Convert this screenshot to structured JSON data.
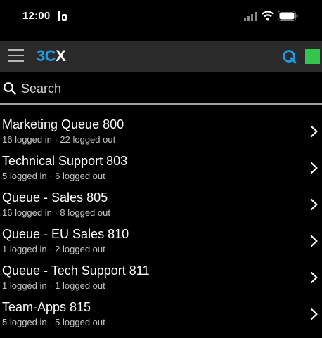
{
  "status_bar": {
    "time": "12:00",
    "icons": [
      "focus-mode-icon",
      "signal-icon",
      "wifi-icon",
      "battery-icon"
    ]
  },
  "header": {
    "logo_prefix": "3",
    "logo_mid": "C",
    "logo_suffix": "X",
    "icons": [
      "menu-icon",
      "q-icon",
      "presence-status"
    ],
    "presence_color": "#33c54d",
    "accent_color": "#1e9be3"
  },
  "search": {
    "placeholder": "Search"
  },
  "queues": [
    {
      "name": "Marketing Queue 800",
      "status": "16 logged in · 22 logged out"
    },
    {
      "name": "Technical Support 803",
      "status": "5 logged in · 6 logged out"
    },
    {
      "name": "Queue - Sales 805",
      "status": "16 logged in · 8 logged out"
    },
    {
      "name": "Queue - EU Sales 810",
      "status": "1 logged in · 2 logged out"
    },
    {
      "name": "Queue - Tech Support 811",
      "status": "1 logged in · 1 logged out"
    },
    {
      "name": "Team-Apps 815",
      "status": "5 logged in · 5 logged out"
    }
  ]
}
